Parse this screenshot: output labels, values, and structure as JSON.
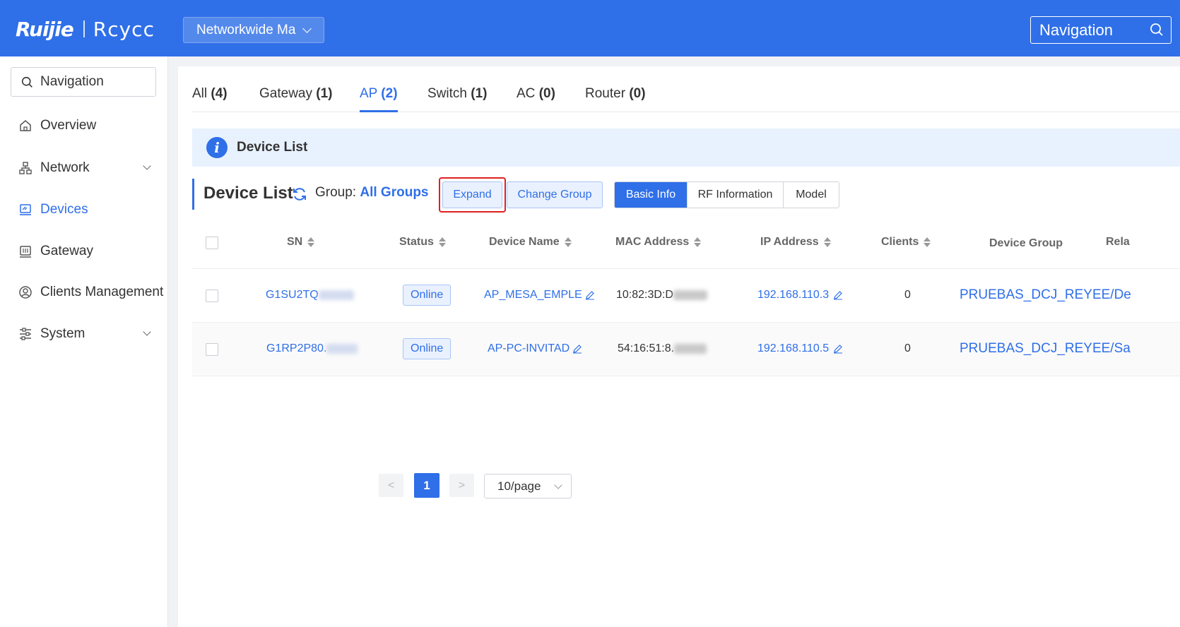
{
  "header": {
    "logo_brand": "Ruijie",
    "logo_product": "Rcycc",
    "network_select": "Networkwide Ma",
    "search_label": "Navigation"
  },
  "sidebar": {
    "search_label": "Navigation",
    "items": [
      {
        "label": "Overview",
        "icon": "home-icon"
      },
      {
        "label": "Network",
        "icon": "network-topology-icon",
        "expandable": true
      },
      {
        "label": "Devices",
        "icon": "devices-icon",
        "active": true
      },
      {
        "label": "Gateway",
        "icon": "gateway-icon"
      },
      {
        "label": "Clients Management",
        "icon": "user-circle-icon"
      },
      {
        "label": "System",
        "icon": "settings-sliders-icon",
        "expandable": true
      }
    ]
  },
  "tabs": [
    {
      "label": "All",
      "count": "(4)"
    },
    {
      "label": "Gateway",
      "count": "(1)"
    },
    {
      "label": "AP",
      "count": "(2)",
      "active": true
    },
    {
      "label": "Switch",
      "count": "(1)"
    },
    {
      "label": "AC",
      "count": "(0)"
    },
    {
      "label": "Router",
      "count": "(0)"
    }
  ],
  "info_bar": {
    "title": "Device List",
    "icon": "info-icon"
  },
  "device_list": {
    "title": "Device List",
    "group_label": "Group:",
    "group_value": "All Groups",
    "expand_button": "Expand",
    "change_group_button": "Change Group",
    "view_tabs": [
      "Basic Info",
      "RF Information",
      "Model"
    ],
    "active_view": "Basic Info"
  },
  "table": {
    "columns": [
      "SN",
      "Status",
      "Device Name",
      "MAC Address",
      "IP Address",
      "Clients",
      "Device Group",
      "Rela"
    ],
    "rows": [
      {
        "sn": "G1SU2TQ",
        "status": "Online",
        "device_name": "AP_MESA_EMPLE",
        "mac": "10:82:3D:D",
        "ip": "192.168.110.3",
        "clients": "0",
        "group": "PRUEBAS_DCJ_REYEE/De"
      },
      {
        "sn": "G1RP2P80.",
        "status": "Online",
        "device_name": "AP-PC-INVITAD",
        "mac": "54:16:51:8.",
        "ip": "192.168.110.5",
        "clients": "0",
        "group": "PRUEBAS_DCJ_REYEE/Sa"
      }
    ]
  },
  "pagination": {
    "current_page": "1",
    "page_size": "10/page",
    "prev": "<",
    "next": ">"
  },
  "colors": {
    "accent": "#2f6fe8",
    "highlight": "#e02020"
  }
}
